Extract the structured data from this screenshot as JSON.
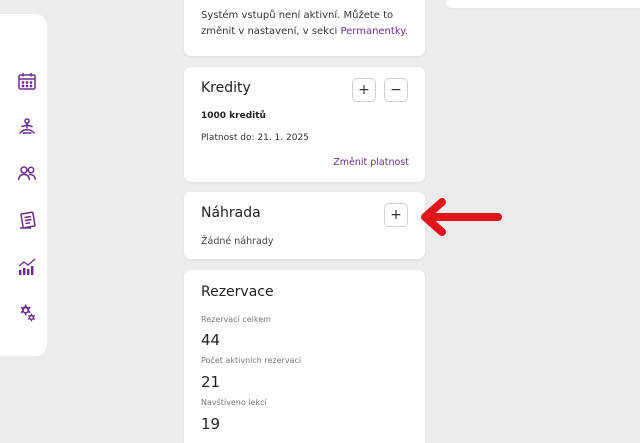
{
  "sidebar": {
    "items": [
      {
        "icon": "calendar-icon"
      },
      {
        "icon": "yoga-icon"
      },
      {
        "icon": "users-icon"
      },
      {
        "icon": "passes-icon"
      },
      {
        "icon": "stats-icon"
      },
      {
        "icon": "settings-icon"
      }
    ]
  },
  "entry_notice": {
    "text": "Systém vstupů není aktivní. Můžete to změnit v nastavení, v sekci ",
    "link": "Permanentky",
    "suffix": "."
  },
  "credits": {
    "title": "Kredity",
    "add_label": "+",
    "remove_label": "−",
    "amount": "1000 kreditů",
    "valid_until": "Platnost do: 21. 1. 2025",
    "change_validity": "Změnit platnost"
  },
  "substitution": {
    "title": "Náhrada",
    "add_label": "+",
    "empty_text": "Žádné náhrady"
  },
  "reservations": {
    "title": "Rezervace",
    "stats": [
      {
        "label": "Rezervací celkem",
        "value": "44"
      },
      {
        "label": "Počet aktivních rezervací",
        "value": "21"
      },
      {
        "label": "Navštíveno lekcí",
        "value": "19"
      }
    ]
  },
  "colors": {
    "accent": "#6b2d8c",
    "arrow": "#e3131b",
    "background": "#ececec"
  }
}
